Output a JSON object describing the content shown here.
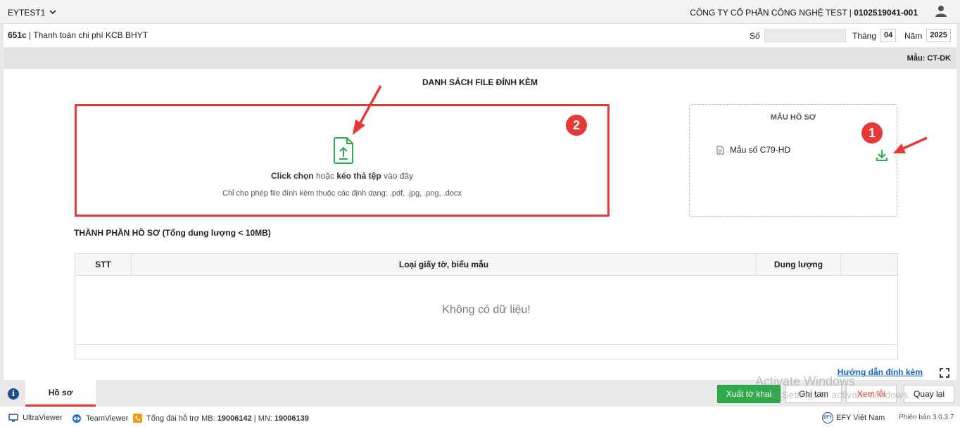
{
  "header": {
    "tenant": "EYTEST1",
    "company_name": "CÔNG TY CỔ PHẦN CÔNG NGHỆ TEST",
    "company_sep": " | ",
    "tax_code": "0102519041-001"
  },
  "docbar": {
    "code": "651c",
    "description": " | Thanh toán chi phí KCB BHYT",
    "so_label": "Số",
    "so_value": "",
    "thang_label": "Tháng",
    "thang_value": "04",
    "nam_label": "Năm",
    "nam_value": "2025"
  },
  "graybar": {
    "mau_label": "Mẫu: CT-DK"
  },
  "main": {
    "title": "DANH SÁCH FILE ĐÍNH KÈM",
    "dropzone": {
      "click_text": "Click chọn",
      "or_text": " hoặc ",
      "drag_text": "kéo thả tệp",
      "here_text": " vào đây",
      "formats_text": "Chỉ cho phép file đính kèm thuộc các định dạng: .pdf, .jpg, .png, .docx"
    },
    "template_box": {
      "heading": "MẪU HỒ SƠ",
      "item_label": "Mẫu số C79-HD"
    },
    "badges": {
      "one": "1",
      "two": "2"
    },
    "section_title": "THÀNH PHẦN HỒ SƠ (Tổng dung lượng < 10MB)",
    "table": {
      "columns": [
        "STT",
        "Loại giấy tờ, biểu mẫu",
        "Dung lượng",
        ""
      ],
      "empty_text": "Không có dữ liệu!"
    },
    "guide_link": "Hướng dẫn đính kèm"
  },
  "footer": {
    "tab_label": "Hồ sơ",
    "buttons": {
      "xuat": "Xuất tờ khai",
      "ghi": "Ghi tạm",
      "xem": "Xem lỗi",
      "quay": "Quay lại"
    },
    "watermark_line1": "Activate Windows",
    "watermark_line2": "Go to Settings to activate Windows."
  },
  "statusbar": {
    "ultraviewer": "UltraViewer",
    "teamviewer": "TeamViewer",
    "hotline_prefix": "Tổng đài hỗ trợ MB: ",
    "hotline_mb": "19006142",
    "hotline_mid": " | MN: ",
    "hotline_mn": "19006139",
    "efy": "EFY Việt Nam",
    "efy_logo": "EFY",
    "version": "Phiên bản 3.0.3.7"
  },
  "colors": {
    "accent_green": "#2eaa4a",
    "annotation_red": "#e53935",
    "link_blue": "#1565c0"
  },
  "icons": [
    "chevron-down-icon",
    "user-icon",
    "upload-file-icon",
    "file-icon",
    "download-icon",
    "expand-icon",
    "info-icon",
    "ultraviewer-icon",
    "teamviewer-icon",
    "phone-icon",
    "efy-logo"
  ]
}
